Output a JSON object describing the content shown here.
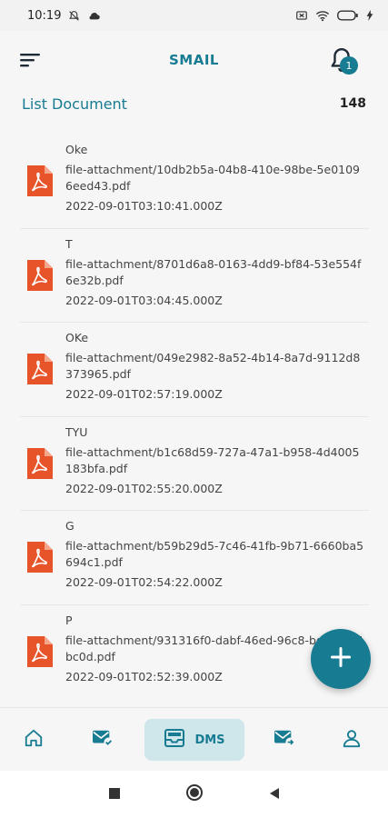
{
  "status_bar": {
    "time": "10:19"
  },
  "app_bar": {
    "title": "SMAIL",
    "notification_count": "1"
  },
  "list_header": {
    "title": "List Document",
    "count": "148"
  },
  "documents": [
    {
      "name": "Oke",
      "path": "file-attachment/10db2b5a-04b8-410e-98be-5e01096eed43.pdf",
      "date": "2022-09-01T03:10:41.000Z"
    },
    {
      "name": "T",
      "path": "file-attachment/8701d6a8-0163-4dd9-bf84-53e554f6e32b.pdf",
      "date": "2022-09-01T03:04:45.000Z"
    },
    {
      "name": "OKe",
      "path": "file-attachment/049e2982-8a52-4b14-8a7d-9112d8373965.pdf",
      "date": "2022-09-01T02:57:19.000Z"
    },
    {
      "name": "TYU",
      "path": "file-attachment/b1c68d59-727a-47a1-b958-4d4005183bfa.pdf",
      "date": "2022-09-01T02:55:20.000Z"
    },
    {
      "name": "G",
      "path": "file-attachment/b59b29d5-7c46-41fb-9b71-6660ba5694c1.pdf",
      "date": "2022-09-01T02:54:22.000Z"
    },
    {
      "name": "P",
      "path": "file-attachment/931316f0-dabf-46ed-96c8-bdbf1334bc0d.pdf",
      "date": "2022-09-01T02:52:39.000Z"
    }
  ],
  "bottom_nav": {
    "items": [
      {
        "icon": "home-icon"
      },
      {
        "icon": "mail-check-icon"
      },
      {
        "icon": "inbox-tray-icon",
        "label": "DMS",
        "active": true
      },
      {
        "icon": "mail-forward-icon"
      },
      {
        "icon": "user-icon"
      }
    ]
  },
  "colors": {
    "primary": "#177c92",
    "pdf": "#e8542a",
    "active_nav_bg": "#cfe6ea"
  }
}
